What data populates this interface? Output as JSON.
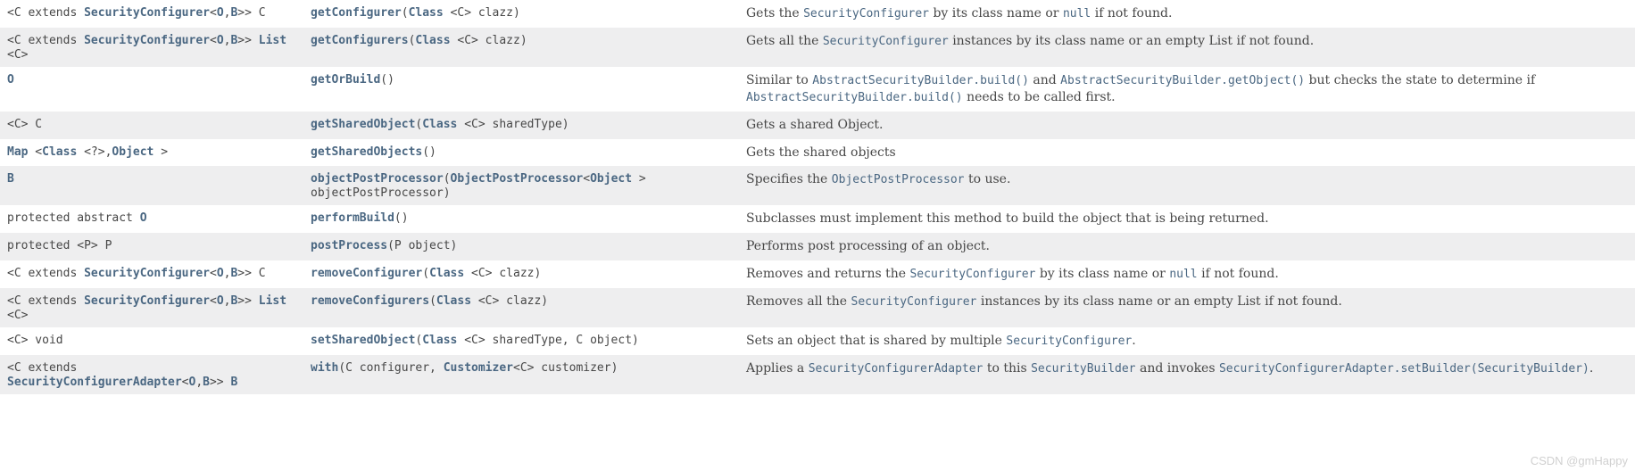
{
  "watermark": "CSDN @gmHappy",
  "rows": [
    {
      "ret": [
        {
          "t": "<C extends "
        },
        {
          "t": "SecurityConfigurer",
          "k": "link"
        },
        {
          "t": "<"
        },
        {
          "t": "O",
          "k": "link"
        },
        {
          "t": ","
        },
        {
          "t": "B",
          "k": "link"
        },
        {
          "t": ">> C"
        }
      ],
      "method_name": "getConfigurer",
      "sig": [
        {
          "t": "("
        },
        {
          "t": "Class",
          "k": "link"
        },
        {
          "t": " <C> clazz)"
        }
      ],
      "desc": [
        {
          "t": "Gets the "
        },
        {
          "t": "SecurityConfigurer",
          "k": "code"
        },
        {
          "t": " by its class name or "
        },
        {
          "t": "null",
          "k": "code"
        },
        {
          "t": " if not found."
        }
      ]
    },
    {
      "ret": [
        {
          "t": "<C extends "
        },
        {
          "t": "SecurityConfigurer",
          "k": "link"
        },
        {
          "t": "<"
        },
        {
          "t": "O",
          "k": "link"
        },
        {
          "t": ","
        },
        {
          "t": "B",
          "k": "link"
        },
        {
          "t": ">> "
        },
        {
          "t": "List",
          "k": "link"
        },
        {
          "t": " <C>"
        }
      ],
      "method_name": "getConfigurers",
      "sig": [
        {
          "t": "("
        },
        {
          "t": "Class",
          "k": "link"
        },
        {
          "t": " <C> clazz)"
        }
      ],
      "desc": [
        {
          "t": "Gets all the "
        },
        {
          "t": "SecurityConfigurer",
          "k": "code"
        },
        {
          "t": " instances by its class name or an empty List if not found."
        }
      ]
    },
    {
      "ret": [
        {
          "t": "O",
          "k": "link"
        }
      ],
      "method_name": "getOrBuild",
      "sig": [
        {
          "t": "()"
        }
      ],
      "desc": [
        {
          "t": "Similar to "
        },
        {
          "t": "AbstractSecurityBuilder.build()",
          "k": "code"
        },
        {
          "t": " and "
        },
        {
          "t": "AbstractSecurityBuilder.getObject()",
          "k": "code"
        },
        {
          "t": " but checks the state to determine if "
        },
        {
          "t": "AbstractSecurityBuilder.build()",
          "k": "code"
        },
        {
          "t": " needs to be called first."
        }
      ]
    },
    {
      "ret": [
        {
          "t": "<C> C"
        }
      ],
      "method_name": "getSharedObject",
      "sig": [
        {
          "t": "("
        },
        {
          "t": "Class",
          "k": "link"
        },
        {
          "t": " <C> sharedType)"
        }
      ],
      "desc": [
        {
          "t": "Gets a shared Object."
        }
      ]
    },
    {
      "ret": [
        {
          "t": "Map",
          "k": "link"
        },
        {
          "t": " <"
        },
        {
          "t": "Class",
          "k": "link"
        },
        {
          "t": " <?>,"
        },
        {
          "t": "Object",
          "k": "link"
        },
        {
          "t": " >"
        }
      ],
      "method_name": "getSharedObjects",
      "sig": [
        {
          "t": "()"
        }
      ],
      "desc": [
        {
          "t": "Gets the shared objects"
        }
      ]
    },
    {
      "ret": [
        {
          "t": "B",
          "k": "link"
        }
      ],
      "method_name": "objectPostProcessor",
      "sig": [
        {
          "t": "("
        },
        {
          "t": "ObjectPostProcessor",
          "k": "link"
        },
        {
          "t": "<"
        },
        {
          "t": "Object",
          "k": "link"
        },
        {
          "t": " > objectPostProcessor)"
        }
      ],
      "desc": [
        {
          "t": "Specifies the "
        },
        {
          "t": "ObjectPostProcessor",
          "k": "code"
        },
        {
          "t": " to use."
        }
      ]
    },
    {
      "ret": [
        {
          "t": "protected abstract "
        },
        {
          "t": "O",
          "k": "link"
        }
      ],
      "method_name": "performBuild",
      "sig": [
        {
          "t": "()"
        }
      ],
      "desc": [
        {
          "t": "Subclasses must implement this method to build the object that is being returned."
        }
      ]
    },
    {
      "ret": [
        {
          "t": "protected <P> P"
        }
      ],
      "method_name": "postProcess",
      "sig": [
        {
          "t": "(P object)"
        }
      ],
      "desc": [
        {
          "t": "Performs post processing of an object."
        }
      ]
    },
    {
      "ret": [
        {
          "t": "<C extends "
        },
        {
          "t": "SecurityConfigurer",
          "k": "link"
        },
        {
          "t": "<"
        },
        {
          "t": "O",
          "k": "link"
        },
        {
          "t": ","
        },
        {
          "t": "B",
          "k": "link"
        },
        {
          "t": ">> C"
        }
      ],
      "method_name": "removeConfigurer",
      "sig": [
        {
          "t": "("
        },
        {
          "t": "Class",
          "k": "link"
        },
        {
          "t": " <C> clazz)"
        }
      ],
      "desc": [
        {
          "t": "Removes and returns the "
        },
        {
          "t": "SecurityConfigurer",
          "k": "code"
        },
        {
          "t": " by its class name or "
        },
        {
          "t": "null",
          "k": "code"
        },
        {
          "t": " if not found."
        }
      ]
    },
    {
      "ret": [
        {
          "t": "<C extends "
        },
        {
          "t": "SecurityConfigurer",
          "k": "link"
        },
        {
          "t": "<"
        },
        {
          "t": "O",
          "k": "link"
        },
        {
          "t": ","
        },
        {
          "t": "B",
          "k": "link"
        },
        {
          "t": ">> "
        },
        {
          "t": "List",
          "k": "link"
        },
        {
          "t": " <C>"
        }
      ],
      "method_name": "removeConfigurers",
      "sig": [
        {
          "t": "("
        },
        {
          "t": "Class",
          "k": "link"
        },
        {
          "t": " <C> clazz)"
        }
      ],
      "desc": [
        {
          "t": "Removes all the "
        },
        {
          "t": "SecurityConfigurer",
          "k": "code"
        },
        {
          "t": " instances by its class name or an empty List if not found."
        }
      ]
    },
    {
      "ret": [
        {
          "t": "<C> void"
        }
      ],
      "method_name": "setSharedObject",
      "sig": [
        {
          "t": "("
        },
        {
          "t": "Class",
          "k": "link"
        },
        {
          "t": " <C> sharedType, C object)"
        }
      ],
      "desc": [
        {
          "t": "Sets an object that is shared by multiple "
        },
        {
          "t": "SecurityConfigurer",
          "k": "code"
        },
        {
          "t": "."
        }
      ]
    },
    {
      "ret": [
        {
          "t": "<C extends "
        },
        {
          "t": "SecurityConfigurerAdapter",
          "k": "link"
        },
        {
          "t": "<"
        },
        {
          "t": "O",
          "k": "link"
        },
        {
          "t": ","
        },
        {
          "t": "B",
          "k": "link"
        },
        {
          "t": ">> "
        },
        {
          "t": "B",
          "k": "link"
        }
      ],
      "method_name": "with",
      "sig": [
        {
          "t": "(C configurer, "
        },
        {
          "t": "Customizer",
          "k": "link"
        },
        {
          "t": "<C> customizer)"
        }
      ],
      "desc": [
        {
          "t": "Applies a "
        },
        {
          "t": "SecurityConfigurerAdapter",
          "k": "code"
        },
        {
          "t": " to this "
        },
        {
          "t": "SecurityBuilder",
          "k": "code"
        },
        {
          "t": " and invokes "
        },
        {
          "t": "SecurityConfigurerAdapter.setBuilder(SecurityBuilder)",
          "k": "code"
        },
        {
          "t": "."
        }
      ]
    }
  ]
}
